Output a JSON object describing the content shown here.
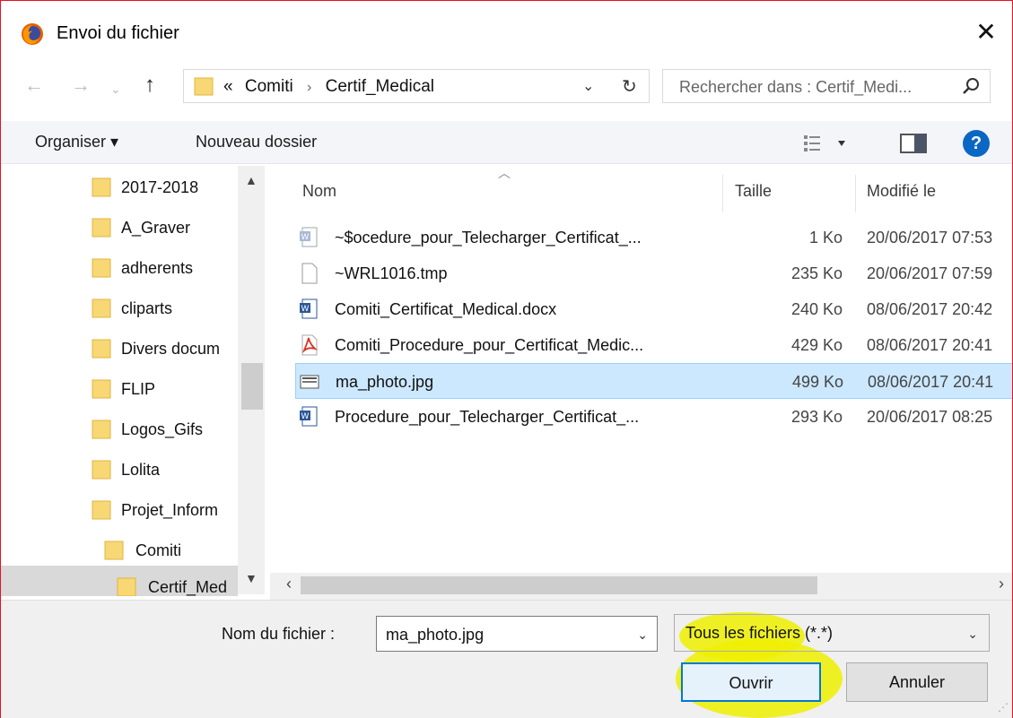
{
  "window": {
    "title": "Envoi du fichier"
  },
  "icons": {
    "app": "firefox-icon",
    "close": "close-icon",
    "back": "arrow-left-icon",
    "forward": "arrow-right-icon",
    "recent": "chevron-down-icon",
    "up": "arrow-up-icon",
    "refresh": "refresh-icon",
    "search": "search-icon",
    "view": "view-options-icon",
    "pane": "preview-pane-icon",
    "help": "help-icon",
    "folder": "folder-icon"
  },
  "colors": {
    "accent": "#0078d7",
    "selection": "#cce8ff",
    "folder": "#f8d775",
    "highlight": "#eef000",
    "frame": "#e81123"
  },
  "address": {
    "prefix": "«",
    "path": [
      "Comiti",
      "Certif_Medical"
    ],
    "separator": "›"
  },
  "search": {
    "placeholder": "Rechercher dans : Certif_Medi..."
  },
  "toolbar": {
    "organize": "Organiser ▾",
    "new_folder": "Nouveau dossier",
    "help_label": "?"
  },
  "nav_tree": [
    {
      "label": "2017-2018"
    },
    {
      "label": "A_Graver"
    },
    {
      "label": "adherents"
    },
    {
      "label": "cliparts"
    },
    {
      "label": "Divers docum"
    },
    {
      "label": "FLIP"
    },
    {
      "label": "Logos_Gifs"
    },
    {
      "label": "Lolita"
    },
    {
      "label": "Projet_Inform"
    },
    {
      "label": "Comiti"
    },
    {
      "label": "Certif_Med"
    }
  ],
  "columns": {
    "name": "Nom",
    "size": "Taille",
    "modified": "Modifié le"
  },
  "files": [
    {
      "name": "~$ocedure_pour_Telecharger_Certificat_...",
      "size": "1 Ko",
      "modified": "20/06/2017 07:53",
      "type": "word-temp-icon"
    },
    {
      "name": "~WRL1016.tmp",
      "size": "235 Ko",
      "modified": "20/06/2017 07:59",
      "type": "blank-file-icon"
    },
    {
      "name": "Comiti_Certificat_Medical.docx",
      "size": "240 Ko",
      "modified": "08/06/2017 20:42",
      "type": "word-icon"
    },
    {
      "name": "Comiti_Procedure_pour_Certificat_Medic...",
      "size": "429 Ko",
      "modified": "08/06/2017 20:41",
      "type": "pdf-icon"
    },
    {
      "name": "ma_photo.jpg",
      "size": "499 Ko",
      "modified": "08/06/2017 20:41",
      "type": "image-icon"
    },
    {
      "name": "Procedure_pour_Telecharger_Certificat_...",
      "size": "293 Ko",
      "modified": "20/06/2017 08:25",
      "type": "word-icon"
    }
  ],
  "selected_file_index": 4,
  "bottom": {
    "filename_label": "Nom du fichier :",
    "filename_value": "ma_photo.jpg",
    "filetype_value": "Tous les fichiers (*.*)",
    "open_button": "Ouvrir",
    "cancel_button": "Annuler"
  }
}
